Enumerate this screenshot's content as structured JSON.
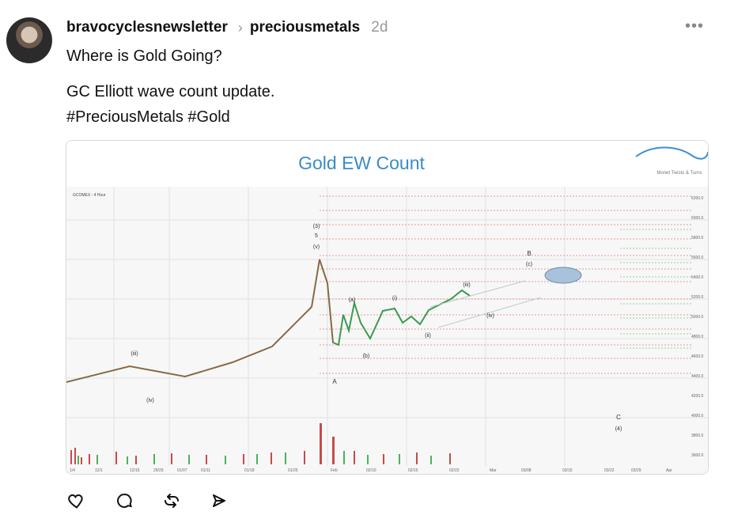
{
  "post": {
    "author": "bravocyclesnewsletter",
    "separator_icon": "chevron-right-icon",
    "community": "preciousmetals",
    "time_ago": "2d",
    "more_icon": "ellipsis-icon",
    "title": "Where is Gold Going?",
    "body_line_1": "GC Elliott wave count update.",
    "body_line_2": "#PreciousMetals #Gold",
    "image": {
      "title": "Gold EW Count",
      "brand": "Monet Twists & Turns",
      "symbol": "GCOMEX - 4 Hour",
      "left_label": "(iii)",
      "left_label_2": "(iv)",
      "wave_top": "(3)",
      "wave_top_2": "5",
      "wave_top_3": "(v)",
      "wave_a": "A",
      "wave_b": "(a)",
      "wave_c": "(b)",
      "wave_i": "(i)",
      "wave_ii": "(ii)",
      "wave_iii": "(iii)",
      "wave_iv": "(iv)",
      "wave_B": "B",
      "wave_c_small": "(c)",
      "wave_C": "C",
      "wave_4": "(4)",
      "x_ticks": [
        "1/4",
        "12/1",
        "12/15",
        "29/29",
        "01/07",
        "01/11",
        "01/18",
        "01/25",
        "Feb",
        "02/10",
        "02/15",
        "02/22",
        "Mar",
        "03/08",
        "03/15",
        "03/22",
        "03/29",
        "Apr"
      ],
      "y_ticks": [
        "6200.0",
        "6000.0",
        "5800.0",
        "5600.0",
        "5400.0",
        "5200.0",
        "5000.0",
        "4800.0",
        "4600.0",
        "4400.0",
        "4200.0",
        "4000.0",
        "3800.0",
        "3600.0"
      ]
    }
  },
  "actions": {
    "like_icon": "heart-icon",
    "comment_icon": "comment-icon",
    "repost_icon": "repost-icon",
    "share_icon": "send-icon"
  }
}
